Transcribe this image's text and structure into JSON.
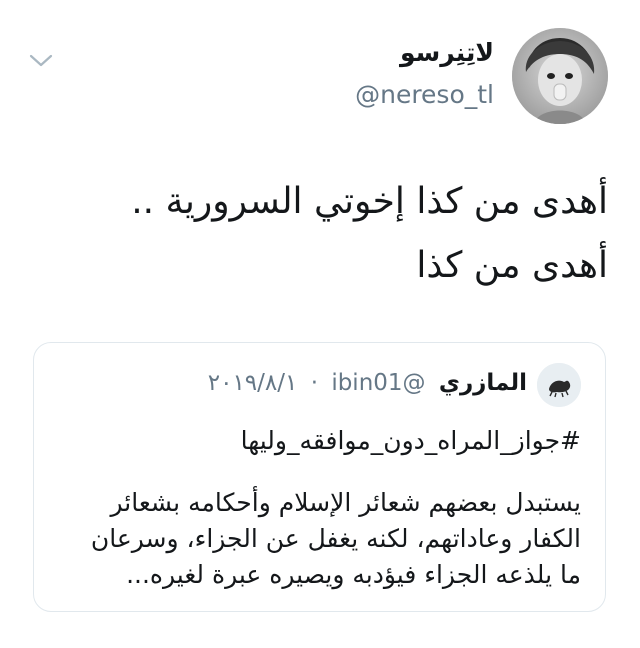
{
  "tweet": {
    "author": {
      "display_name": "لاتِنِرسو",
      "handle": "@nereso_tl"
    },
    "menu_icon": "chevron-down-icon",
    "text_lines": [
      "أهدى من كذا إخوتي السرورية ..",
      "أهدى من كذا"
    ]
  },
  "quoted_tweet": {
    "author": {
      "display_name": "المازري",
      "handle": "@ibin01",
      "date": "٢٠١٩/٨/١"
    },
    "separator": "·",
    "hashtag": "#جواز_المراه_دون_موافقه_وليها",
    "body_lines": [
      "يستبدل بعضهم شعائر الإسلام وأحكامه بشعائر",
      "الكفار وعاداتهم، لكنه يغفل عن الجزاء، وسرعان",
      "ما يلذعه الجزاء فيؤدبه ويصيره عبرة لغيره..."
    ]
  },
  "colors": {
    "text": "#14171a",
    "secondary": "#657786",
    "border": "#e1e8ed",
    "background": "#ffffff"
  }
}
